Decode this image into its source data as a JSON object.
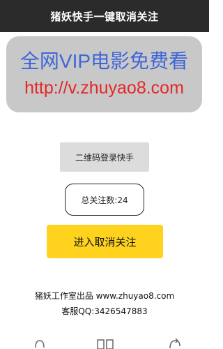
{
  "app": {
    "title": "猪妖快手一键取消关注"
  },
  "banner": {
    "line1": "全网VIP电影免费看",
    "line2": "http://v.zhuyao8.com",
    "line1_color": "#3f66d8",
    "line2_color": "#e62727"
  },
  "actions": {
    "login_label": "二维码登录快手",
    "follow_count_text": "总关注数:24",
    "unfollow_label": "进入取消关注",
    "accent_color": "#ffd21e"
  },
  "footer": {
    "credit": "猪妖工作室出品 www.zhuyao8.com",
    "support": "客服QQ:3426547883"
  },
  "navbar": {
    "icons": [
      "back-icon",
      "recent-apps-icon",
      "refresh-icon"
    ]
  }
}
